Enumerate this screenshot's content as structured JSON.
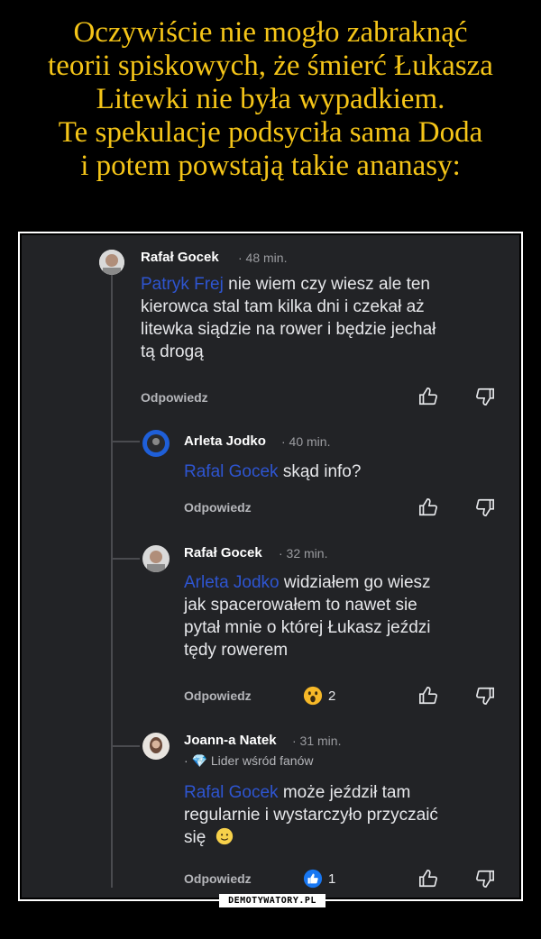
{
  "caption": {
    "line1": "Oczywiście nie mogło zabraknąć",
    "line2": "teorii spiskowych, że śmierć Łukasza",
    "line3": "Litewki nie była wypadkiem.",
    "line4": "Te spekulacje podsyciła sama Doda",
    "line5": "i potem powstają takie ananasy:"
  },
  "comments": [
    {
      "author": "Rafał Gocek",
      "time": "· 48 min.",
      "mention": "Patryk Frej",
      "lines": [
        " nie wiem czy wiesz ale ten",
        "kierowca stal tam kilka dni i czekał aż",
        "litewka siądzie na rower i będzie jechał",
        "tą drogą"
      ],
      "reply_label": "Odpowiedz"
    },
    {
      "author": "Arleta Jodko",
      "time": "· 40 min.",
      "mention": "Rafal Gocek",
      "lines": [
        " skąd info?"
      ],
      "reply_label": "Odpowiedz"
    },
    {
      "author": "Rafał Gocek",
      "time": "· 32 min.",
      "mention": "Arleta Jodko",
      "lines": [
        " widziałem go wiesz",
        "jak spacerowałem to nawet sie",
        "pytał mnie o której Łukasz jeździ",
        "tędy rowerem"
      ],
      "reply_label": "Odpowiedz",
      "reaction_count": "2"
    },
    {
      "author": "Joann-a Natek",
      "time": "· 31 min.",
      "badge": "· 💎 Lider wśród fanów",
      "mention": "Rafal Gocek",
      "lines": [
        " może jeździł tam",
        "regularnie i wystarczyło przyczaić",
        "się"
      ],
      "reply_label": "Odpowiedz",
      "reaction_count": "1"
    }
  ],
  "watermark": "DEMOTYWATORY.PL",
  "colors": {
    "caption": "#f5c518",
    "mention": "#2e55d1",
    "background": "#222326"
  }
}
